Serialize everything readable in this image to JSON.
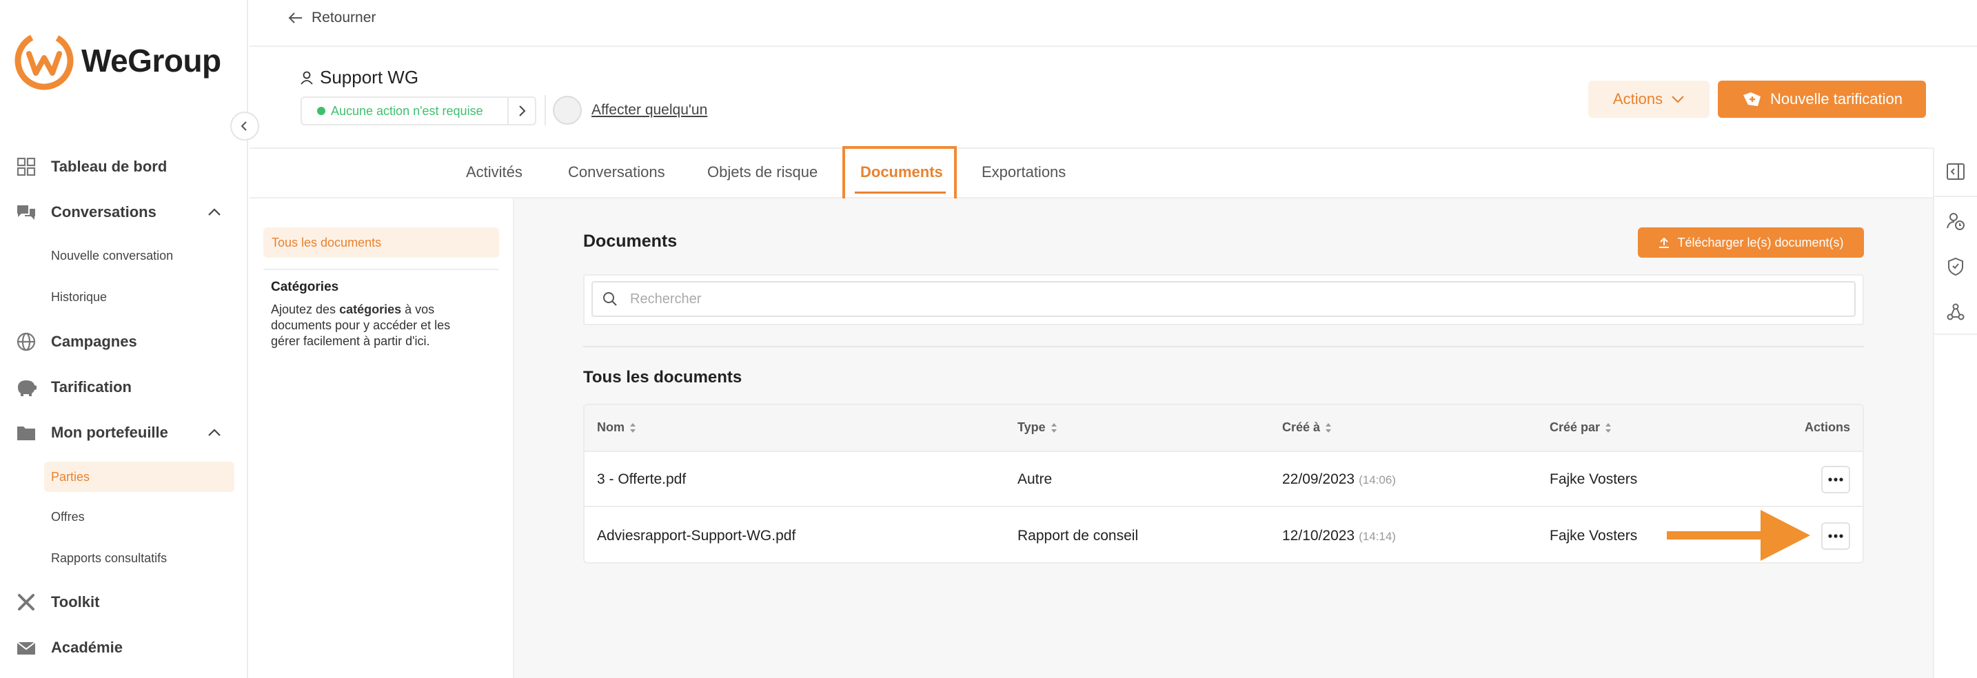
{
  "app": {
    "brand": "WeGroup",
    "accent_color": "#F08A35",
    "status_color": "#3FBF6C"
  },
  "sidebar": {
    "items": [
      {
        "label": "Tableau de bord",
        "icon": "dashboard-icon"
      },
      {
        "label": "Conversations",
        "icon": "chat-icon",
        "expanded": true,
        "children": [
          {
            "label": "Nouvelle conversation"
          },
          {
            "label": "Historique"
          }
        ]
      },
      {
        "label": "Campagnes",
        "icon": "globe-icon"
      },
      {
        "label": "Tarification",
        "icon": "piggy-bank-icon"
      },
      {
        "label": "Mon portefeuille",
        "icon": "folder-icon",
        "expanded": true,
        "children": [
          {
            "label": "Parties",
            "active": true
          },
          {
            "label": "Offres"
          },
          {
            "label": "Rapports consultatifs"
          }
        ]
      },
      {
        "label": "Toolkit",
        "icon": "tools-icon"
      },
      {
        "label": "Académie",
        "icon": "mail-icon"
      }
    ]
  },
  "header": {
    "back_label": "Retourner",
    "party_name": "Support WG",
    "status_text": "Aucune action n'est requise",
    "assign_label": "Affecter quelqu'un",
    "actions_label": "Actions",
    "new_pricing_label": "Nouvelle tarification"
  },
  "tabs": [
    {
      "label": "Activités"
    },
    {
      "label": "Conversations"
    },
    {
      "label": "Objets de risque"
    },
    {
      "label": "Documents",
      "active": true
    },
    {
      "label": "Exportations"
    }
  ],
  "filters": {
    "all_label": "Tous les documents",
    "categories_title": "Catégories",
    "categories_desc_prefix": "Ajoutez des ",
    "categories_desc_bold": "catégories",
    "categories_desc_suffix": " à vos documents pour y accéder et les gérer facilement à partir d'ici."
  },
  "documents": {
    "title": "Documents",
    "upload_label": "Télécharger le(s) document(s)",
    "search_placeholder": "Rechercher",
    "all_title": "Tous les documents",
    "columns": [
      "Nom",
      "Type",
      "Créé à",
      "Créé par",
      "Actions"
    ],
    "rows": [
      {
        "name": "3 - Offerte.pdf",
        "type": "Autre",
        "date": "22/09/2023",
        "time": "(14:06)",
        "created_by": "Fajke Vosters"
      },
      {
        "name": "Adviesrapport-Support-WG.pdf",
        "type": "Rapport de conseil",
        "date": "12/10/2023",
        "time": "(14:14)",
        "created_by": "Fajke Vosters"
      }
    ]
  },
  "right_rail": {
    "icons": [
      "panel-toggle-icon",
      "user-clock-icon",
      "shield-icon",
      "network-icon"
    ]
  }
}
